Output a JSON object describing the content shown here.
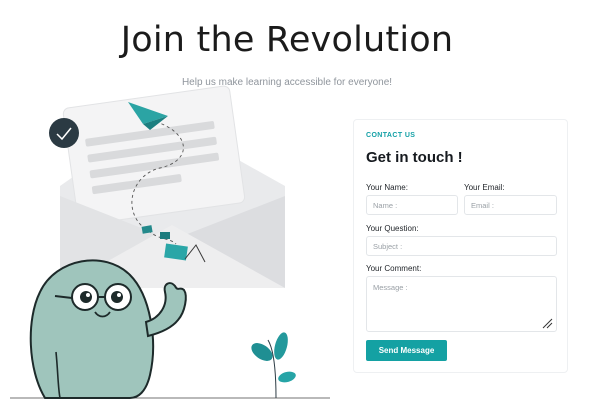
{
  "hero": {
    "title": "Join the Revolution",
    "subtitle": "Help us make learning accessible for everyone!"
  },
  "contact": {
    "eyebrow": "CONTACT US",
    "heading": "Get in touch !",
    "name_label": "Your Name:",
    "name_placeholder": "Name :",
    "email_label": "Your Email:",
    "email_placeholder": "Email :",
    "question_label": "Your Question:",
    "question_placeholder": "Subject :",
    "comment_label": "Your Comment:",
    "comment_placeholder": "Message :",
    "send_label": "Send Message"
  },
  "colors": {
    "accent": "#14a1a3",
    "character": "#9fc5bc"
  },
  "icons": [
    "checkmark-badge-icon",
    "paper-plane-icon",
    "envelope-illustration",
    "mascot-character",
    "plant-illustration",
    "resize-grip-icon"
  ]
}
